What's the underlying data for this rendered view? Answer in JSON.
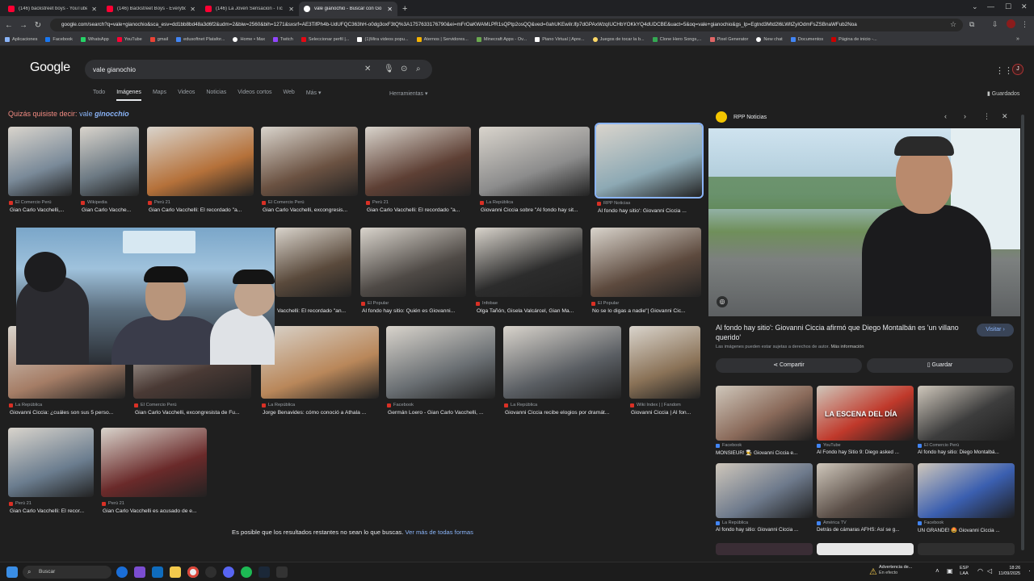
{
  "browser": {
    "tabs": [
      {
        "label": "(146) backstreet boys - YouTube",
        "color": "#ff0033"
      },
      {
        "label": "(146) Backstreet Boys - Everybo",
        "color": "#ff0033"
      },
      {
        "label": "(146) La Joven Sensacion - Tic T",
        "color": "#ff0033"
      },
      {
        "label": "vale gianochio - Buscar con Go",
        "color": "#ffffff"
      }
    ],
    "new_tab": "+",
    "url": "google.com/search?q=vale+gianochio&sca_esv=dd1bb8bd48a3d6f2&udm=2&biw=2560&bih=1271&sxsrf=AE3TifPh4b-UdUFQC363hH-o0dg3oxF3tQ%3A1757633176790&ei=mFrOaKWAMLPR1sQPtp2osQQ&ved=0ahUKEwiIr.lfp7dGPAxWzqIUCHbYOKkYQ4dUDCBE&uact=5&oq=vale+gianochio&gs_lp=Egtnd3Mtd2l6LWltZyIOdmFsZSBnaWFub2Noa",
    "bookmarks": [
      {
        "label": "Aplicaciones",
        "color": "#8ab4f8"
      },
      {
        "label": "Facebook",
        "color": "#1877f2"
      },
      {
        "label": "WhatsApp",
        "color": "#25d366"
      },
      {
        "label": "YouTube",
        "color": "#ff0033"
      },
      {
        "label": "gmail",
        "color": "#ea4335"
      },
      {
        "label": "edusoftnet Platafor...",
        "color": "#4285f4"
      },
      {
        "label": "Home • Max",
        "color": "#ffffff"
      },
      {
        "label": "Twitch",
        "color": "#9146ff"
      },
      {
        "label": "Seleccionar perfil |...",
        "color": "#e50914"
      },
      {
        "label": "(1)Mira videos popu...",
        "color": "#ffffff"
      },
      {
        "label": "Aternos | Servidores...",
        "color": "#f5b301"
      },
      {
        "label": "Minecraft Apps - Ov...",
        "color": "#6aa84f"
      },
      {
        "label": "Piano Virtual | Apre...",
        "color": "#ffffff"
      },
      {
        "label": "Juegos de tocar la b...",
        "color": "#ffd966"
      },
      {
        "label": "Clone Hero Songs,...",
        "color": "#34a853"
      },
      {
        "label": "Pixel Generator",
        "color": "#e06666"
      },
      {
        "label": "New chat",
        "color": "#ffffff"
      },
      {
        "label": "Documentos",
        "color": "#4285f4"
      },
      {
        "label": "Página de inicio -...",
        "color": "#cc0000"
      }
    ]
  },
  "google": {
    "logo": "Google",
    "query": "vale gianochio",
    "tabs": [
      "Todo",
      "Imágenes",
      "Maps",
      "Videos",
      "Noticias",
      "Videos cortos",
      "Web",
      "Más ▾"
    ],
    "tools": "Herramientas ▾",
    "saved": "Guardados",
    "did_you_mean_prefix": "Quizás quisiste decir:",
    "did_you_mean_q1": "vale",
    "did_you_mean_q2": "ginocchio",
    "more_text": "Es posible que los resultados restantes no sean lo que buscas.",
    "more_link": "Ver más de todas formas"
  },
  "results": [
    {
      "source": "El Comercio Perú",
      "title": "Gian Carlo Vacchelli,...",
      "color": "#7a8a99"
    },
    {
      "source": "Wikipedia",
      "title": "Gian Carlo Vacche...",
      "color": "#6d7a84"
    },
    {
      "source": "Perú 21",
      "title": "Gian Carlo Vacchelli: El recordado \"a...",
      "color": "#b5713a"
    },
    {
      "source": "El Comercio Perú",
      "title": "Gian Carlo Vacchelli, excongresis...",
      "color": "#6b5242"
    },
    {
      "source": "Perú 21",
      "title": "Gian Carlo Vacchelli: El recordado \"a...",
      "color": "#5e4035"
    },
    {
      "source": "La República",
      "title": "Giovanni Ciccia sobre \"Al fondo hay sit...",
      "color": "#8c8c8c"
    },
    {
      "source": "RPP Noticias",
      "title": "Al fondo hay sitio': Giovanni Ciccia ...",
      "color": "#8da9b4"
    },
    {
      "source": "",
      "title": "",
      "color": "#4b3f37"
    },
    {
      "source": "",
      "title": "Vacchelli: El recordado \"an...",
      "color": "#5a4a3c"
    },
    {
      "source": "El Popular",
      "title": "Al fondo hay sitio: Quién es Giovanni...",
      "color": "#4f4a46"
    },
    {
      "source": "Infobae",
      "title": "Olga Tañón, Gisela Valcárcel, Gian Ma...",
      "color": "#2c2c2c"
    },
    {
      "source": "El Popular",
      "title": "No se lo digas a nadie\"| Giovanni Cic...",
      "color": "#5d4a3e"
    },
    {
      "source": "La República",
      "title": "Giovanni Ciccia: ¿cuáles son sus 5 perso...",
      "color": "#a57d66"
    },
    {
      "source": "El Comercio Perú",
      "title": "Gian Carlo Vacchelli, excongresista de Fu...",
      "color": "#4a3a35"
    },
    {
      "source": "La República",
      "title": "Jorge Benavides: cómo conoció a Athala ...",
      "color": "#b9875a"
    },
    {
      "source": "Facebook",
      "title": "Germán Loero - Gian Carlo Vacchelli, ...",
      "color": "#6a6f73"
    },
    {
      "source": "La República",
      "title": "Giovanni Ciccia recibe elogios por dramát...",
      "color": "#5a5e63"
    },
    {
      "source": "Wiki Index | | Fandom",
      "title": "Giovanni Ciccia | Al fon...",
      "color": "#8a7257"
    },
    {
      "source": "Perú 21",
      "title": "Gian Carlo Vacchelli: El recor...",
      "color": "#6b7d8f"
    },
    {
      "source": "Perú 21",
      "title": "Gian Carlo Vacchelli es acusado de e...",
      "color": "#6a2a2a"
    }
  ],
  "panel": {
    "source": "RPP Noticias",
    "title": "Al fondo hay sitio': Giovanni Ciccia afirmó que Diego Montalbán es 'un villano querido'",
    "visit": "Visitar ›",
    "rights_prefix": "Las imágenes pueden estar sujetas a derechos de autor.",
    "rights_link": "Más información",
    "share": "Compartir",
    "save": "Guardar",
    "related": [
      {
        "source": "Facebook",
        "title": "MONSIEUR! 👨‍🍳 Giovanni Ciccia e...",
        "color": "#8a6a5a"
      },
      {
        "source": "YouTube",
        "title": "Al Fondo hay Sitio 9: Diego asked ...",
        "color": "#c0392b",
        "overlay": "LA ESCENA DEL DÍA"
      },
      {
        "source": "El Comercio Perú",
        "title": "Al fondo hay sitio: Diego Montalbá...",
        "color": "#3d3d3d"
      },
      {
        "source": "La República",
        "title": "Al fondo hay sitio: Giovanni Ciccia ...",
        "color": "#6e7a8c"
      },
      {
        "source": "América TV",
        "title": "Detrás de cámaras AFHS: Así se g...",
        "color": "#5b4f48"
      },
      {
        "source": "Facebook",
        "title": "UN GRANDE! 🤩 Giovanni Ciccia ...",
        "color": "#3b5fb0"
      }
    ]
  },
  "taskbar": {
    "search": "Buscar",
    "warning_title": "Advertencia de...",
    "warning_sub": "En efecto",
    "lang1": "ESP",
    "lang2": "LAA",
    "time": "18:26",
    "date": "11/09/2025"
  }
}
